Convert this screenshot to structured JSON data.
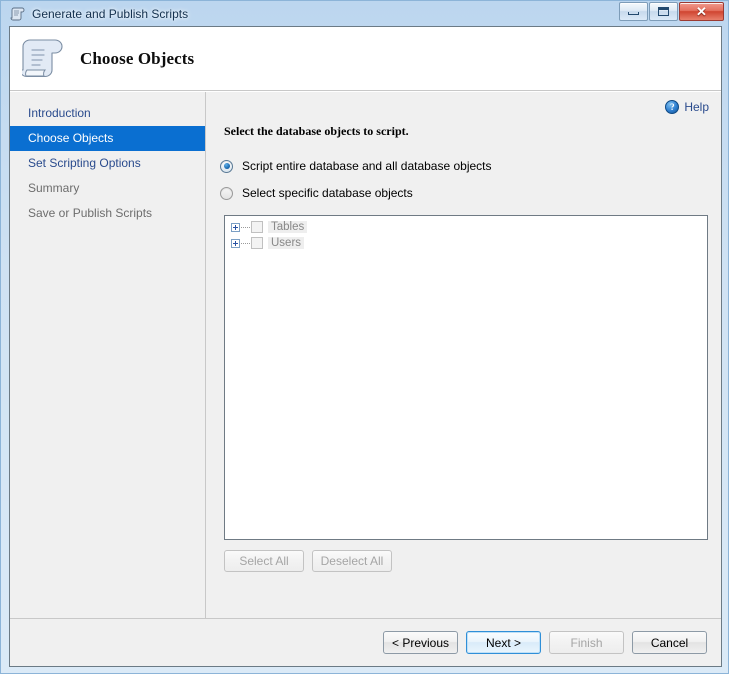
{
  "window": {
    "title": "Generate and Publish Scripts",
    "title_icon": "script-scroll-icon",
    "controls": {
      "minimize": "minimize-icon",
      "maximize": "maximize-icon",
      "close": "✕"
    }
  },
  "header": {
    "title": "Choose Objects",
    "icon": "script-scroll-icon"
  },
  "sidebar": {
    "items": [
      {
        "label": "Introduction",
        "state": "enabled"
      },
      {
        "label": "Choose Objects",
        "state": "active"
      },
      {
        "label": "Set Scripting Options",
        "state": "enabled"
      },
      {
        "label": "Summary",
        "state": "disabled"
      },
      {
        "label": "Save or Publish Scripts",
        "state": "disabled"
      }
    ]
  },
  "main": {
    "help": {
      "label": "Help",
      "icon": "help-question-icon"
    },
    "instruction": "Select the database objects to script.",
    "radios": [
      {
        "label": "Script entire database and all database objects",
        "checked": true
      },
      {
        "label": "Select specific database objects",
        "checked": false
      }
    ],
    "tree": {
      "nodes": [
        {
          "label": "Tables",
          "expanded": false,
          "checked": false
        },
        {
          "label": "Users",
          "expanded": false,
          "checked": false
        }
      ]
    },
    "tree_buttons": [
      {
        "label": "Select All",
        "enabled": false
      },
      {
        "label": "Deselect All",
        "enabled": false
      }
    ]
  },
  "footer": {
    "buttons": [
      {
        "label": "< Previous",
        "enabled": true,
        "default": false
      },
      {
        "label": "Next >",
        "enabled": true,
        "default": true
      },
      {
        "label": "Finish",
        "enabled": false,
        "default": false
      },
      {
        "label": "Cancel",
        "enabled": true,
        "default": false
      }
    ]
  },
  "colors": {
    "accent": "#0a6fd1",
    "link": "#2a4b8d",
    "panel": "#f0f0f0",
    "close_button": "#cf4430"
  }
}
